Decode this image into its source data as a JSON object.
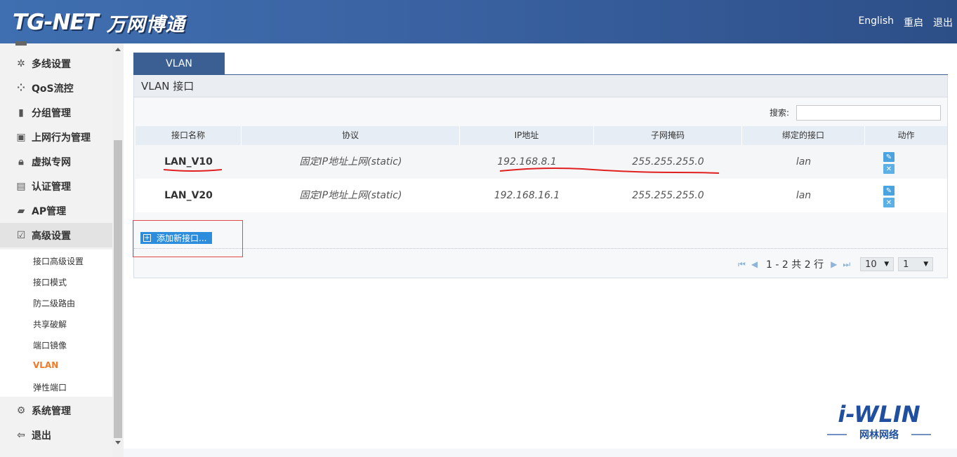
{
  "header": {
    "logo_en": "TG-NET",
    "logo_cn": "万网博通",
    "links": [
      "English",
      "重启",
      "退出"
    ]
  },
  "sidebar": {
    "items": [
      {
        "label": "多线设置",
        "icon": "multi-line-icon"
      },
      {
        "label": "QoS流控",
        "icon": "qos-icon"
      },
      {
        "label": "分组管理",
        "icon": "group-icon"
      },
      {
        "label": "上网行为管理",
        "icon": "behavior-icon"
      },
      {
        "label": "虚拟专网",
        "icon": "vpn-lock-icon"
      },
      {
        "label": "认证管理",
        "icon": "auth-icon"
      },
      {
        "label": "AP管理",
        "icon": "ap-icon"
      },
      {
        "label": "高级设置",
        "icon": "advanced-icon"
      },
      {
        "label": "系统管理",
        "icon": "gear-icon"
      },
      {
        "label": "退出",
        "icon": "logout-icon"
      }
    ],
    "submenu": [
      "接口高级设置",
      "接口模式",
      "防二级路由",
      "共享破解",
      "端口镜像",
      "VLAN",
      "弹性端口"
    ],
    "current_submenu": "VLAN"
  },
  "main": {
    "tab": "VLAN",
    "panel_title": "VLAN 接口",
    "search_label": "搜索:",
    "search_value": "",
    "columns": [
      "接口名称",
      "协议",
      "IP地址",
      "子网掩码",
      "绑定的接口",
      "动作"
    ],
    "rows": [
      {
        "name": "LAN_V10",
        "protocol": "固定IP地址上网(static)",
        "ip": "192.168.8.1",
        "mask": "255.255.255.0",
        "bind": "lan"
      },
      {
        "name": "LAN_V20",
        "protocol": "固定IP地址上网(static)",
        "ip": "192.168.16.1",
        "mask": "255.255.255.0",
        "bind": "lan"
      }
    ],
    "add_button": "添加新接口...",
    "pager": {
      "summary": "1 - 2 共 2 行",
      "page_size": "10",
      "page": "1"
    }
  },
  "watermark": {
    "brand": "i-WLIN",
    "tagline": "网林网络"
  },
  "colors": {
    "header": "#3a62a2",
    "tab": "#3c5f93",
    "current_submenu": "#f07a26",
    "annotation": "#e24a4a",
    "add_button": "#2c8ddd"
  }
}
